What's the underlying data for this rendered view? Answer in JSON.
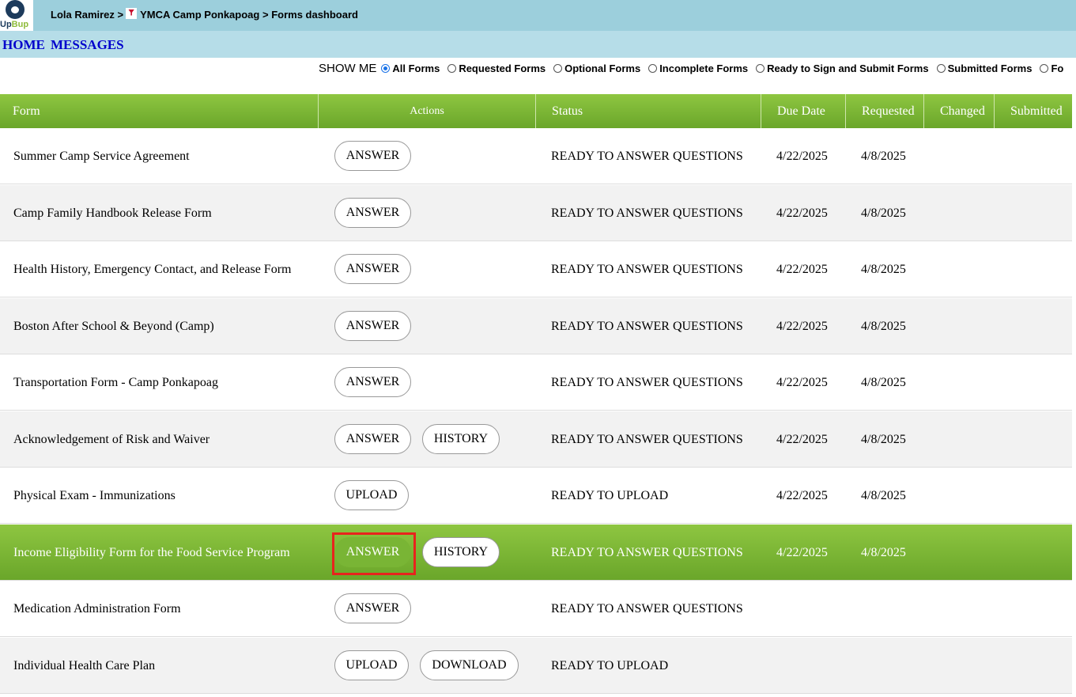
{
  "header": {
    "logo_text_1": "Up",
    "logo_text_2": "Bup",
    "breadcrumb_user": "Lola Ramirez",
    "breadcrumb_sep": ">",
    "breadcrumb_camp": "YMCA Camp Ponkapoag",
    "breadcrumb_page": "Forms dashboard"
  },
  "nav": {
    "home": "HOME",
    "messages": "MESSAGES"
  },
  "filter": {
    "label": "SHOW ME",
    "options": [
      "All Forms",
      "Requested Forms",
      "Optional Forms",
      "Incomplete Forms",
      "Ready to Sign and Submit Forms",
      "Submitted Forms",
      "Fo"
    ],
    "selected": "All Forms"
  },
  "table": {
    "headers": {
      "form": "Form",
      "actions": "Actions",
      "status": "Status",
      "due": "Due Date",
      "requested": "Requested",
      "changed": "Changed",
      "submitted": "Submitted"
    },
    "rows": [
      {
        "form": "Summer Camp Service Agreement",
        "actions": [
          "ANSWER"
        ],
        "status": "READY TO ANSWER QUESTIONS",
        "due": "4/22/2025",
        "requested": "4/8/2025"
      },
      {
        "form": "Camp Family Handbook Release Form",
        "actions": [
          "ANSWER"
        ],
        "status": "READY TO ANSWER QUESTIONS",
        "due": "4/22/2025",
        "requested": "4/8/2025"
      },
      {
        "form": "Health History, Emergency Contact, and Release Form",
        "actions": [
          "ANSWER"
        ],
        "status": "READY TO ANSWER QUESTIONS",
        "due": "4/22/2025",
        "requested": "4/8/2025"
      },
      {
        "form": "Boston After School & Beyond (Camp)",
        "actions": [
          "ANSWER"
        ],
        "status": "READY TO ANSWER QUESTIONS",
        "due": "4/22/2025",
        "requested": "4/8/2025"
      },
      {
        "form": "Transportation Form - Camp Ponkapoag",
        "actions": [
          "ANSWER"
        ],
        "status": "READY TO ANSWER QUESTIONS",
        "due": "4/22/2025",
        "requested": "4/8/2025"
      },
      {
        "form": "Acknowledgement of Risk and Waiver",
        "actions": [
          "ANSWER",
          "HISTORY"
        ],
        "status": "READY TO ANSWER QUESTIONS",
        "due": "4/22/2025",
        "requested": "4/8/2025"
      },
      {
        "form": "Physical Exam - Immunizations",
        "actions": [
          "UPLOAD"
        ],
        "status": "READY TO UPLOAD",
        "due": "4/22/2025",
        "requested": "4/8/2025"
      },
      {
        "form": "Income Eligibility Form for the Food Service Program",
        "actions": [
          "ANSWER",
          "HISTORY"
        ],
        "status": "READY TO ANSWER QUESTIONS",
        "due": "4/22/2025",
        "requested": "4/8/2025",
        "selected": true
      },
      {
        "form": "Medication Administration Form",
        "actions": [
          "ANSWER"
        ],
        "status": "READY TO ANSWER QUESTIONS",
        "due": "",
        "requested": ""
      },
      {
        "form": "Individual Health Care Plan",
        "actions": [
          "UPLOAD",
          "DOWNLOAD"
        ],
        "status": "READY TO UPLOAD",
        "due": "",
        "requested": ""
      }
    ]
  },
  "colors": {
    "header_bg": "#9ccfdc",
    "nav_bg": "#b6dde8",
    "table_green": "#7ab535",
    "highlight": "#e8231d",
    "link": "#0000cc"
  }
}
